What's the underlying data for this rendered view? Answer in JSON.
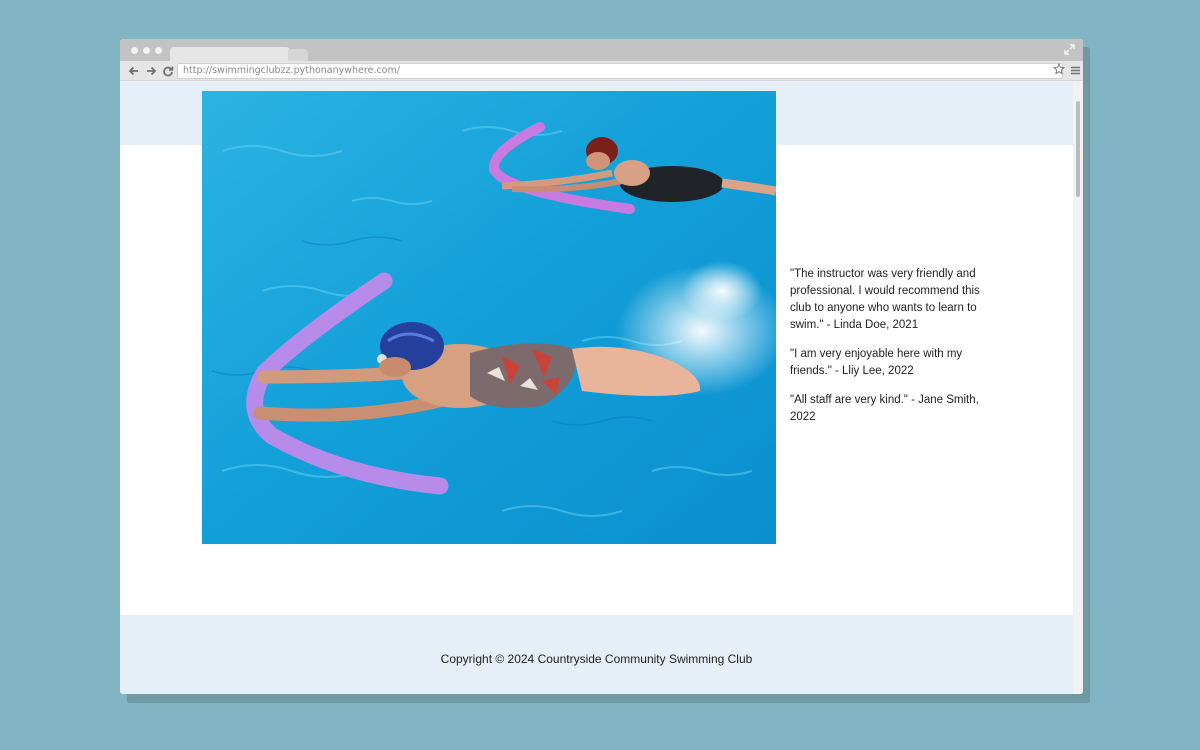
{
  "browser": {
    "url": "http://swimmingclubzz.pythonanywhere.com/",
    "icons": [
      "back-arrow-icon",
      "forward-arrow-icon",
      "reload-icon",
      "bookmark-star-icon",
      "menu-icon",
      "expand-icon"
    ]
  },
  "main": {
    "photo_alt": "Two swimmers using pool noodles in a blue swimming pool",
    "testimonials": [
      "\"The instructor was very friendly and professional. I would recommend this club to anyone who wants to learn to swim.\" - Linda Doe, 2021",
      "\"I am very enjoyable here with my friends.\" - Lliy Lee, 2022",
      "\"All staff are very kind.\" - Jane Smith, 2022"
    ]
  },
  "footer": {
    "copyright": "Copyright © 2024 Countryside Community Swimming Club"
  },
  "colors": {
    "desktop": "#81b5c3",
    "band": "#e6eff7",
    "water": "#1aa7da",
    "noodle": "#b58be8"
  }
}
